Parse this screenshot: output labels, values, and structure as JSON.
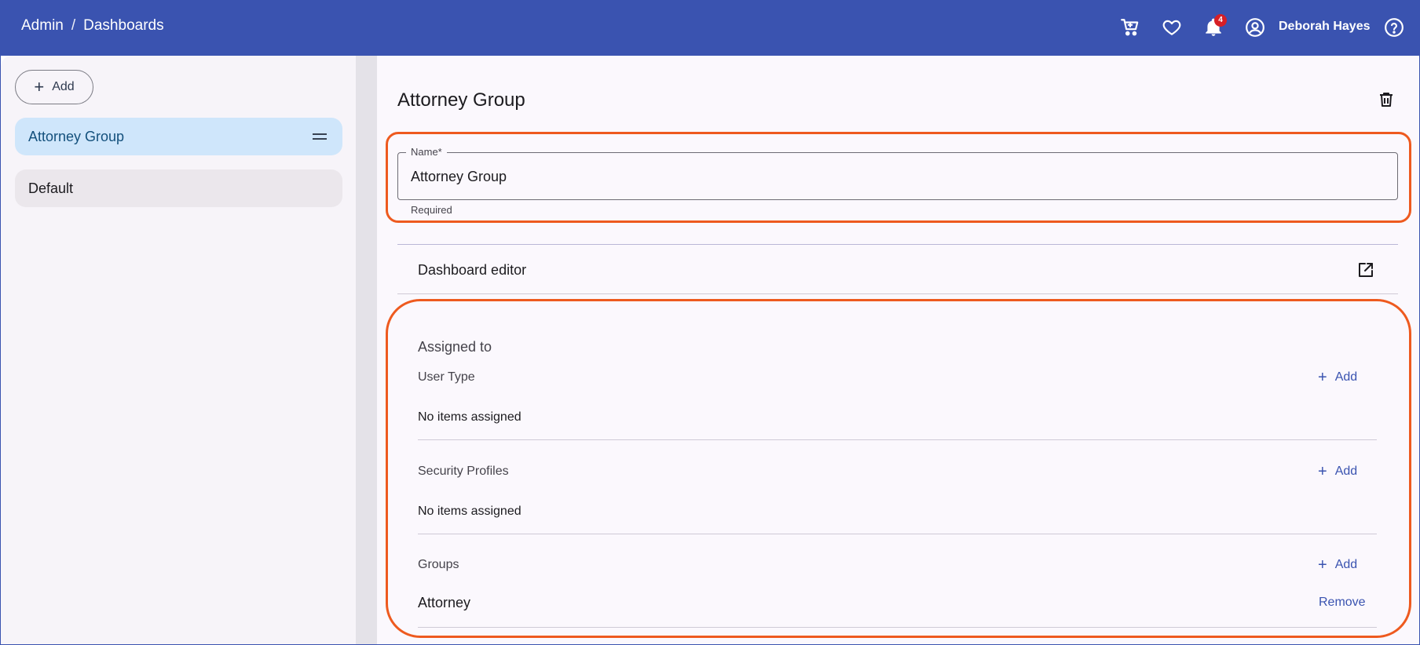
{
  "header": {
    "breadcrumb": [
      "Admin",
      "/",
      "Dashboards"
    ],
    "notification_count": "4",
    "user_name": "Deborah Hayes",
    "icons": [
      "cart-icon",
      "heart-icon",
      "bell-icon",
      "account-icon",
      "help-icon"
    ]
  },
  "sidebar": {
    "add_label": "Add",
    "items": [
      {
        "label": "Attorney Group",
        "selected": true
      },
      {
        "label": "Default",
        "selected": false
      }
    ]
  },
  "main": {
    "title": "Attorney Group",
    "name_field": {
      "label": "Name*",
      "value": "Attorney Group",
      "helper": "Required"
    },
    "dashboard_editor_label": "Dashboard editor",
    "assigned_to": {
      "heading": "Assigned to",
      "sections": [
        {
          "label": "User Type",
          "add_label": "Add",
          "empty_text": "No items assigned"
        },
        {
          "label": "Security Profiles",
          "add_label": "Add",
          "empty_text": "No items assigned"
        },
        {
          "label": "Groups",
          "add_label": "Add",
          "items": [
            {
              "name": "Attorney",
              "action": "Remove"
            }
          ]
        }
      ]
    }
  },
  "colors": {
    "topbar": "#3a53b0",
    "highlight": "#ee5a1f",
    "selected_item": "#cfe6fb",
    "link": "#3a53b0"
  }
}
